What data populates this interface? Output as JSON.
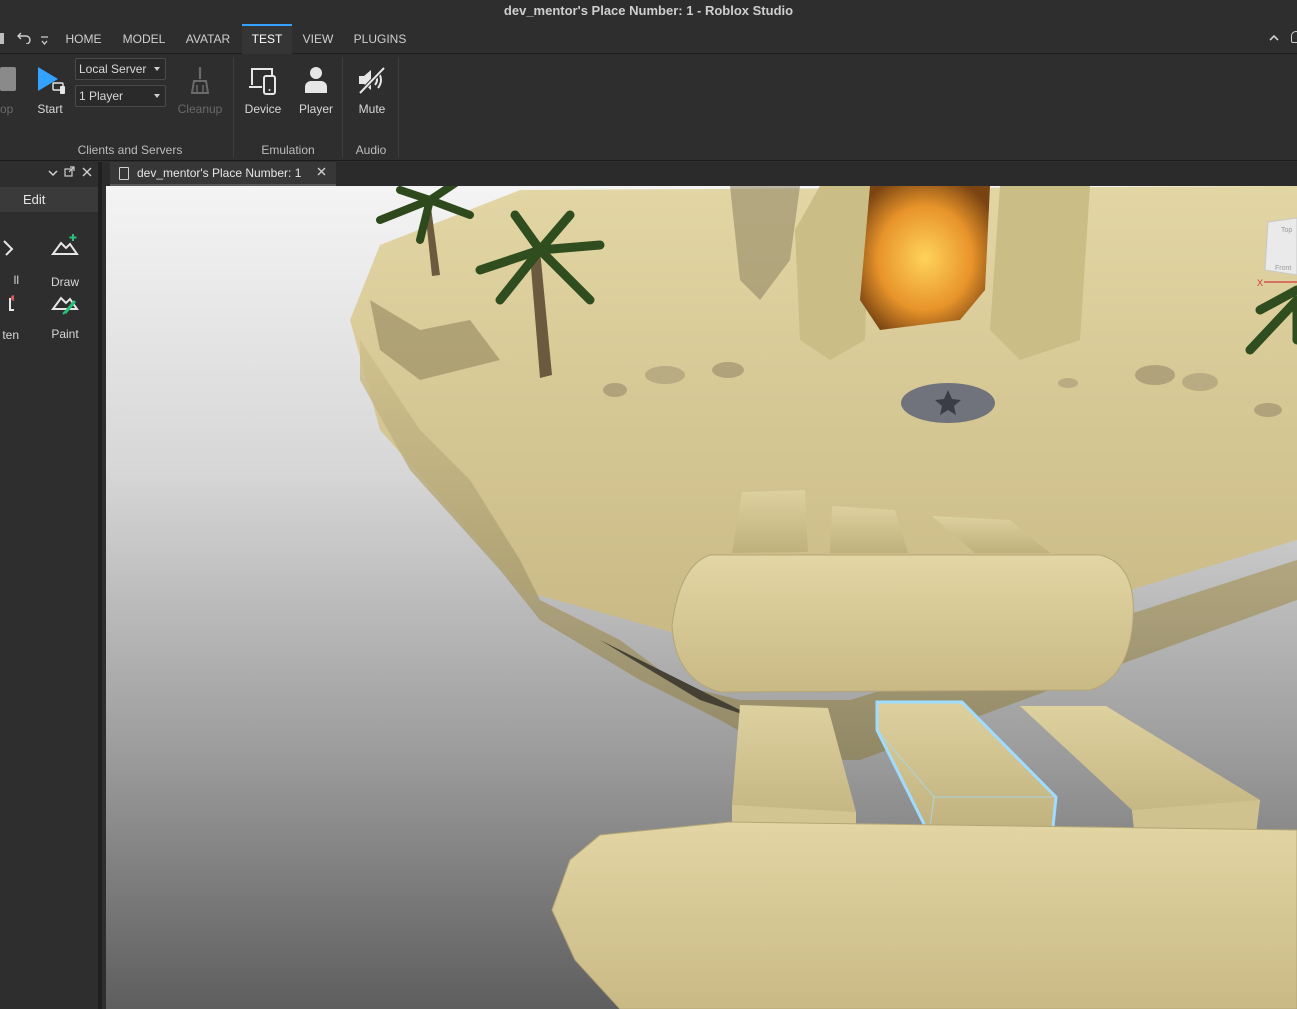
{
  "window": {
    "title": "dev_mentor's Place Number: 1 - Roblox Studio"
  },
  "menu": {
    "tabs": [
      "HOME",
      "MODEL",
      "AVATAR",
      "TEST",
      "VIEW",
      "PLUGINS"
    ],
    "active": "TEST"
  },
  "ribbon": {
    "stop_partial": "op",
    "start": "Start",
    "server_mode": "Local Server",
    "players": "1 Player",
    "cleanup": "Cleanup",
    "device": "Device",
    "player": "Player",
    "mute": "Mute",
    "groups": {
      "clients_servers": "Clients and Servers",
      "emulation": "Emulation",
      "audio": "Audio"
    }
  },
  "left_panel": {
    "tab": "Edit",
    "tools": {
      "fill_partial": "ll",
      "draw": "Draw",
      "flatten_partial": "ten",
      "paint": "Paint"
    }
  },
  "document": {
    "tab_name": "dev_mentor's Place Number: 1"
  },
  "view_cube": {
    "top": "Top",
    "front": "Front",
    "axis_x": "X"
  },
  "colors": {
    "accent": "#33a3ff",
    "selection": "#9fdcff",
    "background": "#2e2e2e",
    "sand": "#d8cb97"
  }
}
